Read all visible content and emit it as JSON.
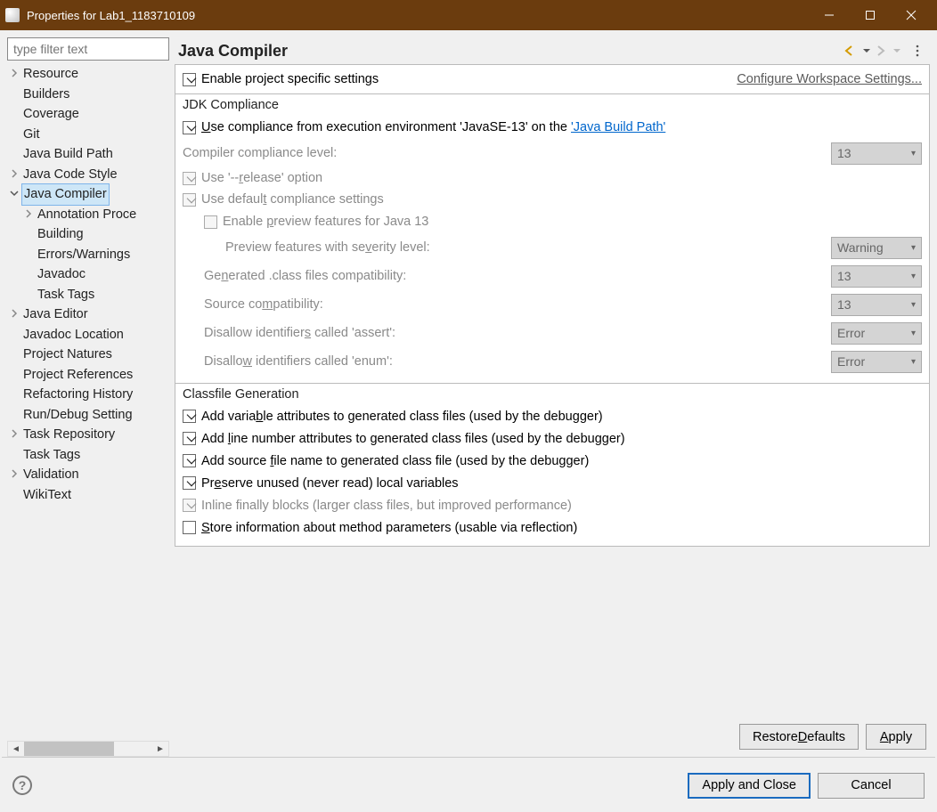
{
  "window": {
    "title": "Properties for Lab1_1183710109"
  },
  "filter": {
    "placeholder": "type filter text"
  },
  "tree": {
    "items": [
      {
        "label": "Resource",
        "depth": 0,
        "expandable": true,
        "expanded": false,
        "selected": false
      },
      {
        "label": "Builders",
        "depth": 0,
        "expandable": false,
        "selected": false
      },
      {
        "label": "Coverage",
        "depth": 0,
        "expandable": false,
        "selected": false
      },
      {
        "label": "Git",
        "depth": 0,
        "expandable": false,
        "selected": false
      },
      {
        "label": "Java Build Path",
        "depth": 0,
        "expandable": false,
        "selected": false
      },
      {
        "label": "Java Code Style",
        "depth": 0,
        "expandable": true,
        "expanded": false,
        "selected": false
      },
      {
        "label": "Java Compiler",
        "depth": 0,
        "expandable": true,
        "expanded": true,
        "selected": true
      },
      {
        "label": "Annotation Proce",
        "depth": 1,
        "expandable": true,
        "expanded": false,
        "selected": false
      },
      {
        "label": "Building",
        "depth": 1,
        "expandable": false,
        "selected": false
      },
      {
        "label": "Errors/Warnings",
        "depth": 1,
        "expandable": false,
        "selected": false
      },
      {
        "label": "Javadoc",
        "depth": 1,
        "expandable": false,
        "selected": false
      },
      {
        "label": "Task Tags",
        "depth": 1,
        "expandable": false,
        "selected": false
      },
      {
        "label": "Java Editor",
        "depth": 0,
        "expandable": true,
        "expanded": false,
        "selected": false
      },
      {
        "label": "Javadoc Location",
        "depth": 0,
        "expandable": false,
        "selected": false
      },
      {
        "label": "Project Natures",
        "depth": 0,
        "expandable": false,
        "selected": false
      },
      {
        "label": "Project References",
        "depth": 0,
        "expandable": false,
        "selected": false
      },
      {
        "label": "Refactoring History",
        "depth": 0,
        "expandable": false,
        "selected": false
      },
      {
        "label": "Run/Debug Setting",
        "depth": 0,
        "expandable": false,
        "selected": false
      },
      {
        "label": "Task Repository",
        "depth": 0,
        "expandable": true,
        "expanded": false,
        "selected": false
      },
      {
        "label": "Task Tags",
        "depth": 0,
        "expandable": false,
        "selected": false
      },
      {
        "label": "Validation",
        "depth": 0,
        "expandable": true,
        "expanded": false,
        "selected": false
      },
      {
        "label": "WikiText",
        "depth": 0,
        "expandable": false,
        "selected": false
      }
    ]
  },
  "page": {
    "title": "Java Compiler",
    "enable_project_specific": {
      "checked": true,
      "label_pre": "Enable pro",
      "label_u": "j",
      "label_post": "ect specific settings"
    },
    "configure_link": "Configure Workspace Settings..."
  },
  "jdk": {
    "title": "JDK Compliance",
    "use_exec_env": {
      "checked": true,
      "pre": "",
      "u": "U",
      "mid": "se compliance from execution environment 'JavaSE-13' on the ",
      "link": "'Java Build Path'"
    },
    "compliance_level": {
      "label": "Compiler compliance level:",
      "value": "13"
    },
    "use_release": {
      "checked": true,
      "pre": "Use '--",
      "u": "r",
      "post": "elease' option"
    },
    "use_default": {
      "checked": true,
      "pre": "Use defaul",
      "u": "t",
      "post": " compliance settings"
    },
    "enable_preview": {
      "checked": false,
      "pre": "Enable ",
      "u": "p",
      "post": "review features for Java 13"
    },
    "preview_severity": {
      "pre": "Preview features with se",
      "u": "v",
      "post": "erity level:",
      "value": "Warning"
    },
    "generated_class": {
      "pre": "Ge",
      "u": "n",
      "post": "erated .class files compatibility:",
      "value": "13"
    },
    "source_compat": {
      "pre": "Source co",
      "u": "m",
      "post": "patibility:",
      "value": "13"
    },
    "disallow_assert": {
      "pre": "Disallow identifier",
      "u": "s",
      "post": " called 'assert':",
      "value": "Error"
    },
    "disallow_enum": {
      "pre": "Disallo",
      "u": "w",
      "post": " identifiers called 'enum':",
      "value": "Error"
    }
  },
  "classfile": {
    "title": "Classfile Generation",
    "items": [
      {
        "checked": true,
        "disabled": false,
        "pre": "Add varia",
        "u": "b",
        "post": "le attributes to generated class files (used by the debugger)"
      },
      {
        "checked": true,
        "disabled": false,
        "pre": "Add ",
        "u": "l",
        "post": "ine number attributes to generated class files (used by the debugger)"
      },
      {
        "checked": true,
        "disabled": false,
        "pre": "Add source ",
        "u": "f",
        "post": "ile name to generated class file (used by the debugger)"
      },
      {
        "checked": true,
        "disabled": false,
        "pre": "Pr",
        "u": "e",
        "post": "serve unused (never read) local variables"
      },
      {
        "checked": true,
        "disabled": true,
        "pre": "Inline finally blocks (larger class files, but improved performance)",
        "u": "",
        "post": ""
      },
      {
        "checked": false,
        "disabled": false,
        "pre": "",
        "u": "S",
        "post": "tore information about method parameters (usable via reflection)"
      }
    ]
  },
  "buttons": {
    "restore": {
      "pre": "Restore ",
      "u": "D",
      "post": "efaults"
    },
    "apply": {
      "pre": "",
      "u": "A",
      "post": "pply"
    },
    "apply_close": "Apply and Close",
    "cancel": "Cancel"
  }
}
